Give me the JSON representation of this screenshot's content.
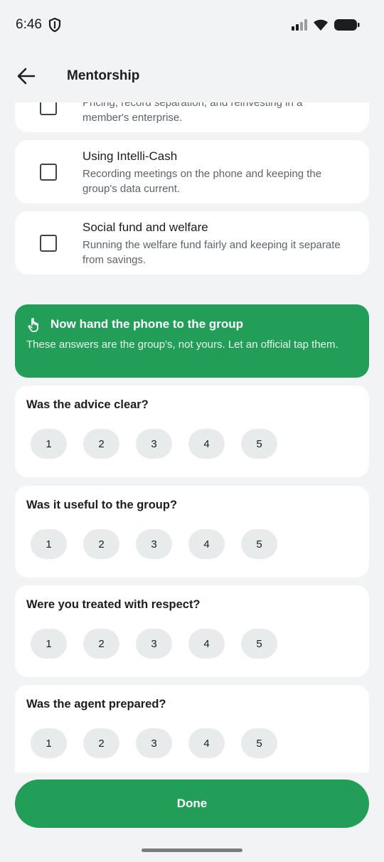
{
  "status_bar": {
    "time": "6:46"
  },
  "app_bar": {
    "title": "Mentorship"
  },
  "topics": [
    {
      "title": "",
      "desc": "Pricing, record separation, and reinvesting in a member's enterprise.",
      "checked": false
    },
    {
      "title": "Using Intelli-Cash",
      "desc": "Recording meetings on the phone and keeping the group's data current.",
      "checked": false
    },
    {
      "title": "Social fund and welfare",
      "desc": "Running the welfare fund fairly and keeping it separate from savings.",
      "checked": false
    }
  ],
  "banner": {
    "title": "Now hand the phone to the group",
    "text": "These answers are the group's, not yours. Let an official tap them.",
    "color": "#229e58"
  },
  "questions": [
    {
      "text": "Was the advice clear?",
      "options": [
        "1",
        "2",
        "3",
        "4",
        "5"
      ]
    },
    {
      "text": "Was it useful to the group?",
      "options": [
        "1",
        "2",
        "3",
        "4",
        "5"
      ]
    },
    {
      "text": "Were you treated with respect?",
      "options": [
        "1",
        "2",
        "3",
        "4",
        "5"
      ]
    },
    {
      "text": "Was the agent prepared?",
      "options": [
        "1",
        "2",
        "3",
        "4",
        "5"
      ]
    }
  ],
  "done_button": {
    "label": "Done"
  },
  "colors": {
    "accent": "#229e58",
    "background": "#f2f3f4",
    "pill": "#e7ebec"
  }
}
